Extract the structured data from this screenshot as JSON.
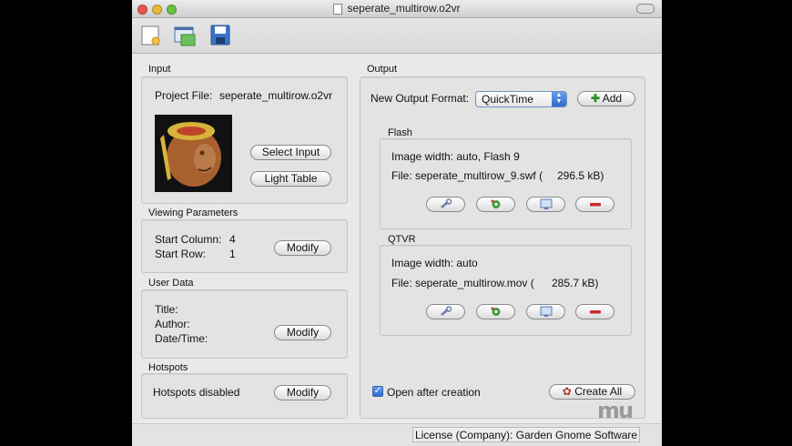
{
  "window": {
    "title": "seperate_multirow.o2vr"
  },
  "toolbar": {
    "buttons": [
      "new-project-icon",
      "open-project-icon",
      "save-project-icon"
    ]
  },
  "input": {
    "label": "Input",
    "project_file_label": "Project File:",
    "project_file_value": "seperate_multirow.o2vr",
    "select_input": "Select Input",
    "light_table": "Light Table"
  },
  "viewing": {
    "label": "Viewing Parameters",
    "start_column_label": "Start Column:",
    "start_column_value": "4",
    "start_row_label": "Start Row:",
    "start_row_value": "1",
    "modify": "Modify"
  },
  "user_data": {
    "label": "User Data",
    "title_label": "Title:",
    "author_label": "Author:",
    "datetime_label": "Date/Time:",
    "modify": "Modify"
  },
  "hotspots": {
    "label": "Hotspots",
    "status": "Hotspots disabled",
    "modify": "Modify"
  },
  "output": {
    "label": "Output",
    "format_label": "New Output Format:",
    "format_value": "QuickTime",
    "add": "Add",
    "flash": {
      "label": "Flash",
      "image_width": "Image width: auto, Flash 9",
      "file": "File: seperate_multirow_9.swf (",
      "size": "296.5 kB)"
    },
    "qtvr": {
      "label": "QTVR",
      "image_width": "Image width: auto",
      "file": "File: seperate_multirow.mov (",
      "size": "285.7 kB)"
    },
    "open_after": "Open after creation",
    "open_after_checked": true,
    "create_all": "Create All"
  },
  "status": {
    "license": "License (Company): Garden Gnome Software"
  },
  "watermark": "mu"
}
